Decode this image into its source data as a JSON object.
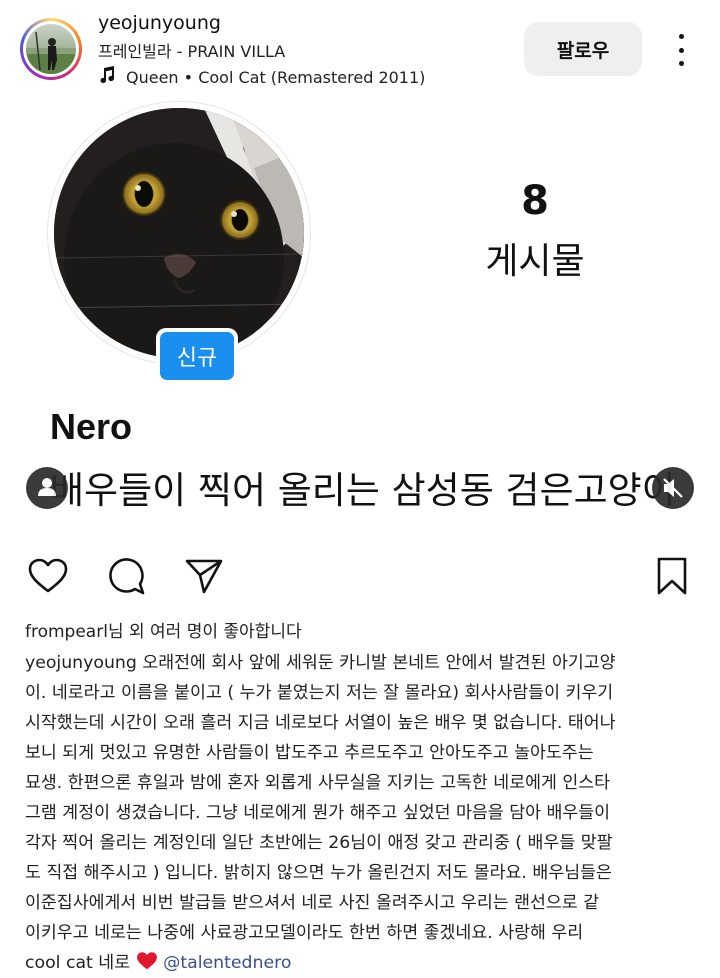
{
  "header": {
    "username": "yeojunyoung",
    "location": "프레인빌라 - PRAIN VILLA",
    "music_artist": "Queen",
    "music_separator": "•",
    "music_track": "Cool Cat (Remastered 2011)",
    "follow_label": "팔로우"
  },
  "media": {
    "badge": "신규",
    "post_count": "8",
    "post_label": "게시물",
    "name": "Nero",
    "description": "배우들이 찍어 올리는 삼성동 검은고양이"
  },
  "likes": "frompearl님 외 여러 명이 좋아합니다",
  "caption": {
    "username": "yeojunyoung",
    "line1": " 오래전에 회사 앞에 세워둔 카니발 본네트 안에서 발견된 아기고양",
    "lines": [
      "이. 네로라고 이름을 붙이고 ( 누가 붙였는지 저는 잘 몰라요) 회사사람들이 키우기",
      "시작했는데 시간이 오래 흘러 지금 네로보다 서열이 높은 배우 몇 없습니다. 태어나",
      "보니 되게 멋있고 유명한 사람들이 밥도주고 추르도주고 안아도주고 놀아도주는",
      "묘생. 한편으론 휴일과 밤에 혼자 외롭게 사무실을 지키는 고독한 네로에게 인스타",
      "그램 계정이 생겼습니다. 그냥 네로에게 뭔가 해주고 싶었던 마음을 담아 배우들이",
      "각자 찍어 올리는 계정인데 일단 초반에는 26님이 애정 갖고 관리중 ( 배우들 맞팔",
      "도 직접 해주시고 ) 입니다. 밝히지 않으면 누가 올린건지 저도 몰라요. 배우님들은",
      "이준집사에게서 비번 발급들 받으셔서 네로 사진 올려주시고 우리는 랜선으로 같",
      "이키우고 네로는 나중에 사료광고모델이라도 한번 하면 좋겠네요. 사랑해 우리"
    ],
    "last_prefix": "cool cat 네로 ",
    "mention": "@talentednero"
  },
  "colors": {
    "follow_bg": "#efefef",
    "badge_blue": "#1a8ff0",
    "mention": "#3b4f8e",
    "heart_red": "#e0182d"
  }
}
